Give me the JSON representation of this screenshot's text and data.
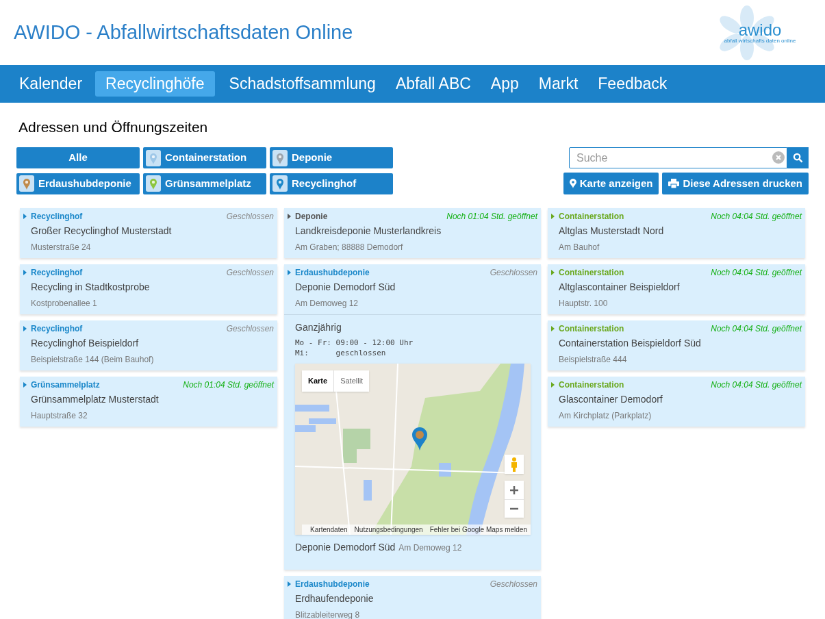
{
  "header": {
    "title": "AWIDO - Abfallwirtschaftsdaten Online",
    "logo_text": "awido",
    "logo_tagline": "abfall wirtschafts daten online"
  },
  "nav": [
    {
      "label": "Kalender",
      "selected": false
    },
    {
      "label": "Recyclinghöfe",
      "selected": true
    },
    {
      "label": "Schadstoffsammlung",
      "selected": false
    },
    {
      "label": "Abfall ABC",
      "selected": false
    },
    {
      "label": "App",
      "selected": false
    },
    {
      "label": "Markt",
      "selected": false
    },
    {
      "label": "Feedback",
      "selected": false
    }
  ],
  "heading": "Adressen und Öffnungszeiten",
  "filters": [
    {
      "label": "Alle"
    },
    {
      "label": "Containerstation",
      "color": "#9ec7e8"
    },
    {
      "label": "Deponie",
      "color": "#9aa4ad"
    },
    {
      "label": "Erdaushubdeponie",
      "color": "#c08a4a"
    },
    {
      "label": "Grünsammelplatz",
      "color": "#8cc63f"
    },
    {
      "label": "Recyclinghof",
      "color": "#1a87c9"
    }
  ],
  "search": {
    "placeholder": "Suche"
  },
  "actions": [
    {
      "label": "Karte anzeigen",
      "kind": "map"
    },
    {
      "label": "Diese Adressen drucken",
      "kind": "print"
    }
  ],
  "columns": [
    [
      {
        "category": "Recyclinghof",
        "color": "#1a87c9",
        "status": "Geschlossen",
        "open": false,
        "name": "Großer Recyclinghof Musterstadt",
        "address": "Musterstraße 24"
      },
      {
        "category": "Recyclinghof",
        "color": "#1a87c9",
        "status": "Geschlossen",
        "open": false,
        "name": "Recycling in Stadtkostprobe",
        "address": "Kostprobenallee 1"
      },
      {
        "category": "Recyclinghof",
        "color": "#1a87c9",
        "status": "Geschlossen",
        "open": false,
        "name": "Recyclinghof Beispieldorf",
        "address": "Beispielstraße 144 (Beim Bauhof)"
      },
      {
        "category": "Grünsammelplatz",
        "color": "#1a87c9",
        "status": "Noch 01:04 Std. geöffnet",
        "open": true,
        "name": "Grünsammelplatz Musterstadt",
        "address": "Hauptstraße 32"
      }
    ],
    [
      {
        "category": "Deponie",
        "color": "#555555",
        "status": "Noch 01:04 Std. geöffnet",
        "open": true,
        "name": "Landkreisdeponie Musterlandkreis",
        "address": "Am Graben; 88888 Demodorf"
      },
      {
        "category": "Erdaushubdeponie",
        "color": "#1a87c9",
        "status": "Geschlossen",
        "open": false,
        "name": "Deponie Demodorf Süd",
        "address": "Am Demoweg 12",
        "details": {
          "season": "Ganzjährig",
          "hours": [
            "Mo - Fr: 09:00 - 12:00 Uhr",
            "Mi:      geschlossen"
          ],
          "map": {
            "types": [
              {
                "label": "Karte",
                "selected": true
              },
              {
                "label": "Satellit",
                "selected": false
              }
            ],
            "attribution": [
              "Kartendaten",
              "Nutzungsbedingungen",
              "Fehler bei Google Maps melden"
            ]
          },
          "footer_name": "Deponie Demodorf Süd",
          "footer_address": "Am Demoweg 12"
        }
      },
      {
        "category": "Erdaushubdeponie",
        "color": "#1a87c9",
        "status": "Geschlossen",
        "open": false,
        "name": "Erdhaufendeponie",
        "address": "Blitzableiterweg 8"
      }
    ],
    [
      {
        "category": "Containerstation",
        "color": "#6aa81e",
        "status": "Noch 04:04 Std. geöffnet",
        "open": true,
        "name": "Altglas Musterstadt Nord",
        "address": "Am Bauhof"
      },
      {
        "category": "Containerstation",
        "color": "#6aa81e",
        "status": "Noch 04:04 Std. geöffnet",
        "open": true,
        "name": "Altglascontainer Beispieldorf",
        "address": "Hauptstr. 100"
      },
      {
        "category": "Containerstation",
        "color": "#6aa81e",
        "status": "Noch 04:04 Std. geöffnet",
        "open": true,
        "name": "Containerstation Beispieldorf Süd",
        "address": "Beispielstraße 444"
      },
      {
        "category": "Containerstation",
        "color": "#6aa81e",
        "status": "Noch 04:04 Std. geöffnet",
        "open": true,
        "name": "Glascontainer Demodorf",
        "address": "Am Kirchplatz (Parkplatz)"
      }
    ]
  ]
}
